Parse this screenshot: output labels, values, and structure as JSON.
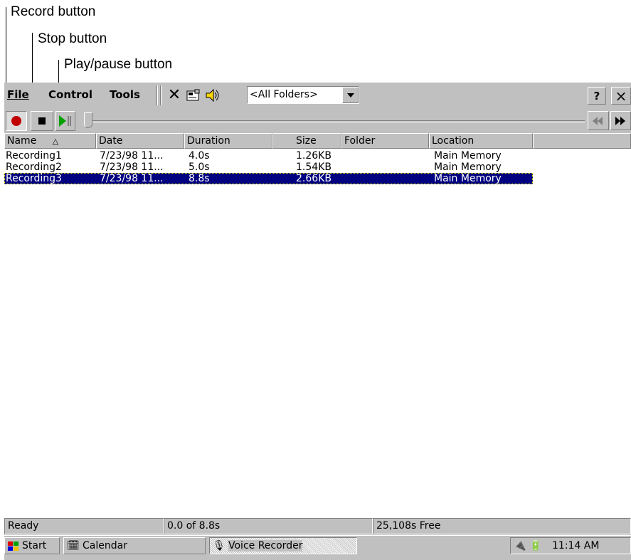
{
  "callouts": {
    "record": "Record button",
    "stop": "Stop button",
    "play": "Play/pause button"
  },
  "menu": {
    "file": "File",
    "control": "Control",
    "tools": "Tools"
  },
  "toolbar": {
    "folder_select": "<All Folders>",
    "help": "?",
    "close": "×"
  },
  "columns": [
    "Name",
    "Date",
    "Duration",
    "Size",
    "Folder",
    "Location"
  ],
  "sort_indicator": "△",
  "rows": [
    {
      "name": "Recording1",
      "date": "7/23/98 11...",
      "duration": "4.0s",
      "size": "1.26KB",
      "folder": "",
      "location": "Main Memory"
    },
    {
      "name": "Recording2",
      "date": "7/23/98 11...",
      "duration": "5.0s",
      "size": "1.54KB",
      "folder": "",
      "location": "Main Memory"
    },
    {
      "name": "Recording3",
      "date": "7/23/98 11...",
      "duration": "8.8s",
      "size": "2.66KB",
      "folder": "",
      "location": "Main Memory"
    }
  ],
  "selected_row": 2,
  "status": {
    "state": "Ready",
    "position": "0.0 of 8.8s",
    "free": "25,108s Free"
  },
  "taskbar": {
    "start": "Start",
    "calendar": "Calendar",
    "voice_recorder": "Voice Recorder",
    "clock": "11:14 AM"
  },
  "colors": {
    "selection": "#000080",
    "record": "#c00000",
    "play": "#00a000",
    "face": "#c0c0c0"
  }
}
